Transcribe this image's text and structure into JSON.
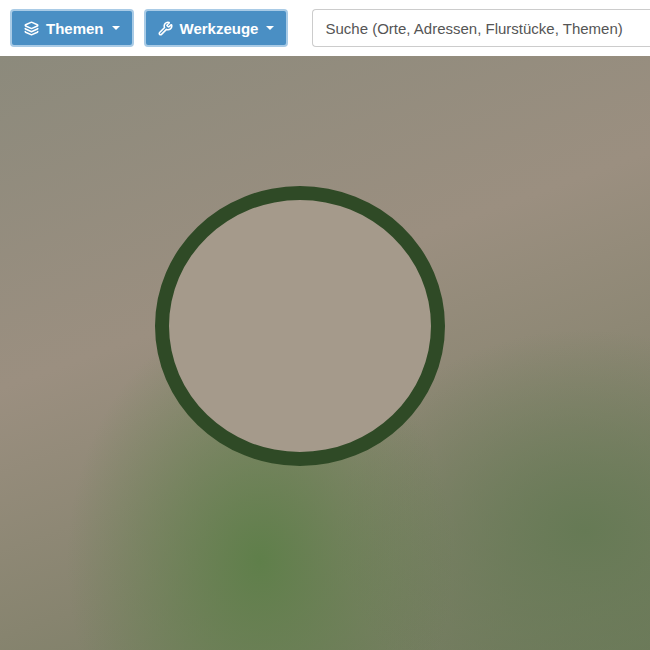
{
  "toolbar": {
    "buttons": [
      {
        "label": "Themen",
        "icon": "layers"
      },
      {
        "label": "Werkzeuge",
        "icon": "wrench"
      }
    ]
  },
  "search": {
    "placeholder": "Suche (Orte, Adressen, Flurstücke, Themen)"
  }
}
